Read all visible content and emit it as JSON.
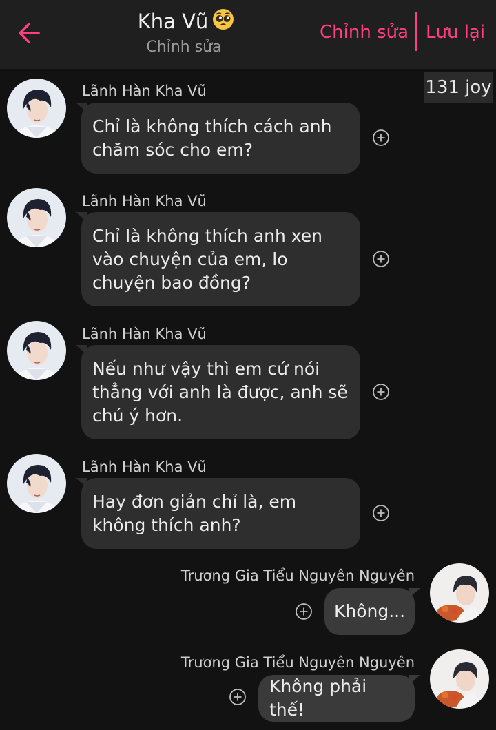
{
  "header": {
    "title": "Kha Vũ",
    "title_emoji": "pleading-face-emoji",
    "subtitle": "Chỉnh sửa",
    "edit_label": "Chỉnh sửa",
    "save_label": "Lưu lại",
    "accent_color": "#ff3f7f"
  },
  "badge": {
    "joy": "131 joy"
  },
  "messages": [
    {
      "sender": "Lãnh Hàn Kha Vũ",
      "side": "left",
      "text": "Chỉ là không thích cách anh chăm sóc cho em?"
    },
    {
      "sender": "Lãnh Hàn Kha Vũ",
      "side": "left",
      "text": "Chỉ là không thích anh xen vào chuyện của em, lo chuyện bao đồng?"
    },
    {
      "sender": "Lãnh Hàn Kha Vũ",
      "side": "left",
      "text": "Nếu như vậy thì em cứ nói thẳng với anh là được, anh sẽ chú ý hơn."
    },
    {
      "sender": "Lãnh Hàn Kha Vũ",
      "side": "left",
      "text": "Hay đơn  giản chỉ là, em không thích anh?"
    },
    {
      "sender": "Trương Gia Tiểu Nguyên Nguyên",
      "side": "right",
      "text": "Không..."
    },
    {
      "sender": "Trương Gia Tiểu Nguyên Nguyên",
      "side": "right",
      "text": "Không phải thế!"
    }
  ]
}
